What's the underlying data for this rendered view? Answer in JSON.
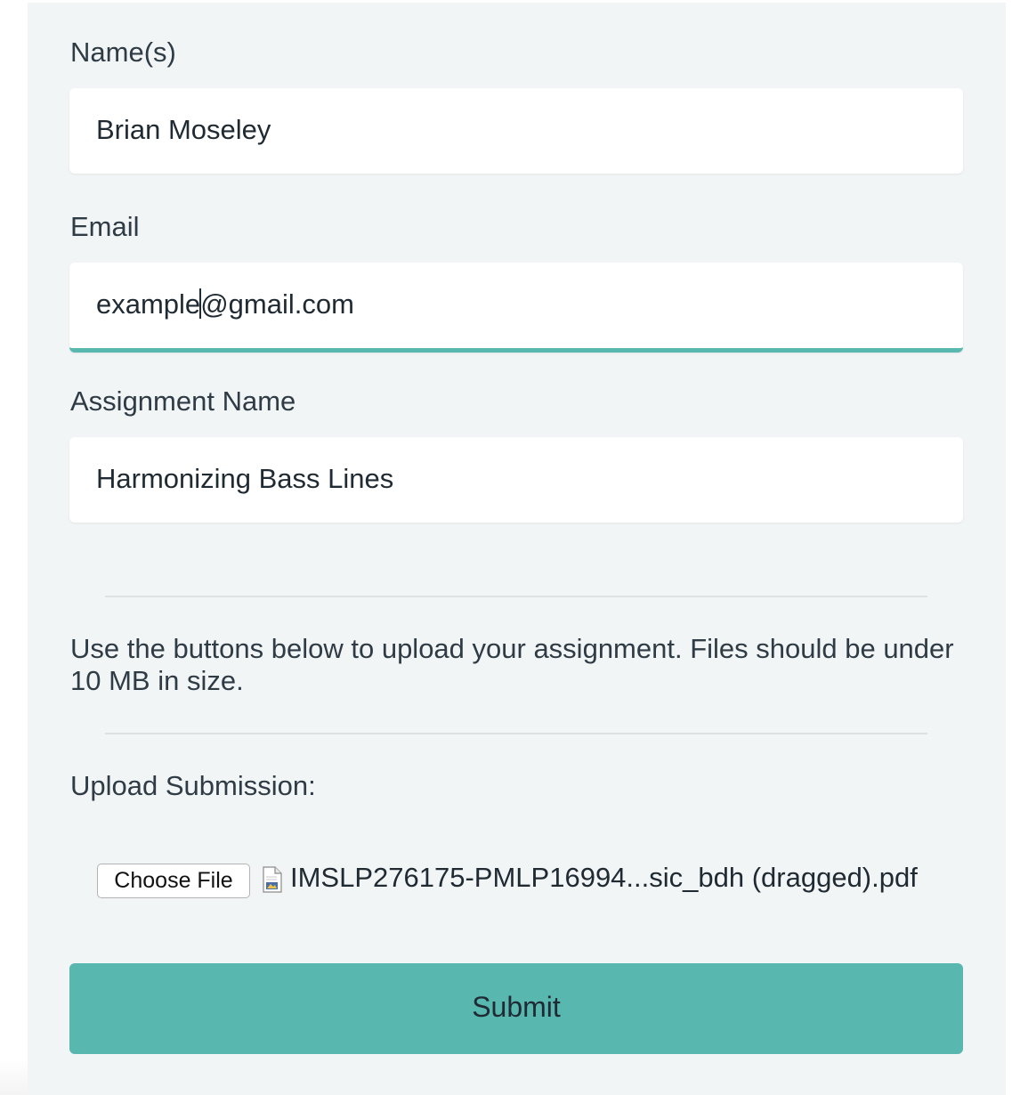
{
  "form": {
    "names_label": "Name(s)",
    "names_value": "Brian Moseley",
    "email_label": "Email",
    "email_value_before_caret": "example",
    "email_value_after_caret": "@gmail.com",
    "assignment_label": "Assignment Name",
    "assignment_value": "Harmonizing Bass Lines",
    "info_text": "Use the buttons below to upload your assignment. Files should be under 10 MB in size.",
    "upload_label": "Upload Submission:",
    "choose_file_label": "Choose File",
    "file_name": "IMSLP276175-PMLP16994...sic_bdh (dragged).pdf",
    "file_icon": "pdf-file-icon",
    "submit_label": "Submit"
  },
  "colors": {
    "accent": "#58b8b0",
    "panel_background": "#f2f5f6",
    "text": "#2f3b45"
  }
}
